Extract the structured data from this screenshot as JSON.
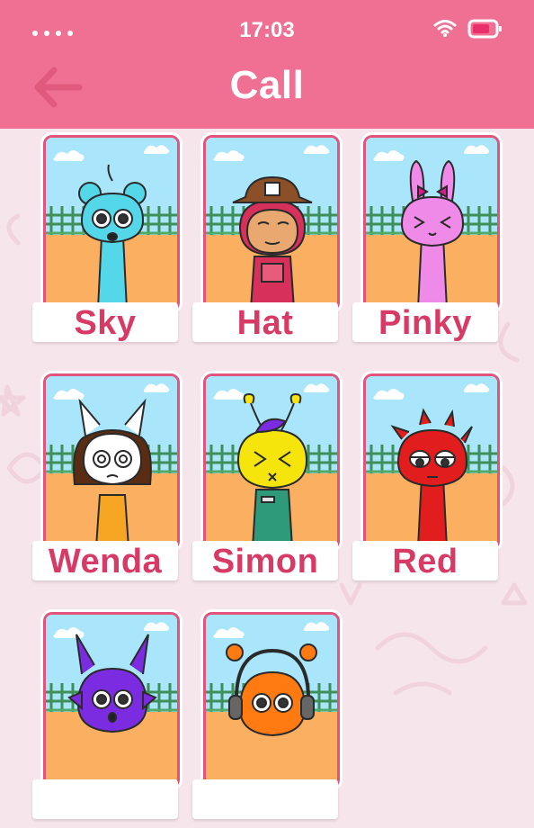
{
  "status_bar": {
    "time": "17:03"
  },
  "header": {
    "title": "Call"
  },
  "characters": [
    {
      "name": "Sky",
      "color": "#55d7ea"
    },
    {
      "name": "Hat",
      "color": "#e8a870"
    },
    {
      "name": "Pinky",
      "color": "#f08ae8"
    },
    {
      "name": "Wenda",
      "color": "#ffffff"
    },
    {
      "name": "Simon",
      "color": "#f5e50c"
    },
    {
      "name": "Red",
      "color": "#e11d1d"
    },
    {
      "name": "",
      "color": "#7b2ce0"
    },
    {
      "name": "",
      "color": "#ff7b12"
    }
  ]
}
